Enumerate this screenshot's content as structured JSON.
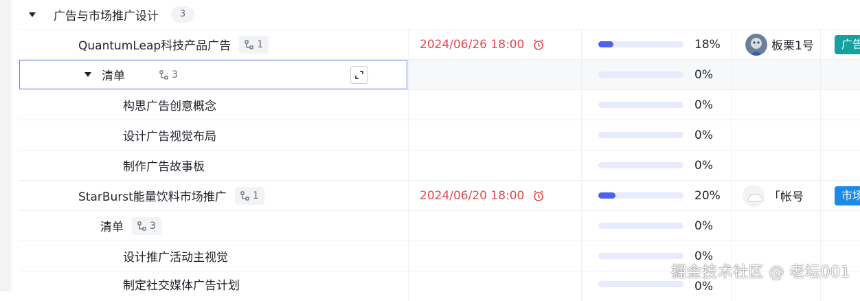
{
  "group": {
    "title": "广告与市场推广设计",
    "count": "3"
  },
  "rows": [
    {
      "name": "QuantumLeap科技产品广告",
      "subtasks": "1",
      "date": "2024/06/26 18:00",
      "progress": 18,
      "progress_label": "18%",
      "user": "板栗1号",
      "tag": "广告",
      "tag_color": "#14a1a1"
    },
    {
      "name": "清单",
      "subtasks": "3",
      "progress": 0,
      "progress_label": "0%"
    },
    {
      "name": "构思广告创意概念",
      "progress": 0,
      "progress_label": "0%"
    },
    {
      "name": "设计广告视觉布局",
      "progress": 0,
      "progress_label": "0%"
    },
    {
      "name": "制作广告故事板",
      "progress": 0,
      "progress_label": "0%"
    },
    {
      "name": "StarBurst能量饮料市场推广",
      "subtasks": "1",
      "date": "2024/06/20 18:00",
      "progress": 20,
      "progress_label": "20%",
      "user": "「帐号",
      "tag": "市场",
      "tag_color": "#1d8ae5"
    },
    {
      "name": "清单",
      "subtasks": "3",
      "progress": 0,
      "progress_label": "0%"
    },
    {
      "name": "设计推广活动主视觉",
      "progress": 0,
      "progress_label": "0%"
    },
    {
      "name": "制定社交媒体广告计划",
      "progress": 0,
      "progress_label": "0%"
    }
  ],
  "watermark": "掘金技术社区 @ 老坛001"
}
